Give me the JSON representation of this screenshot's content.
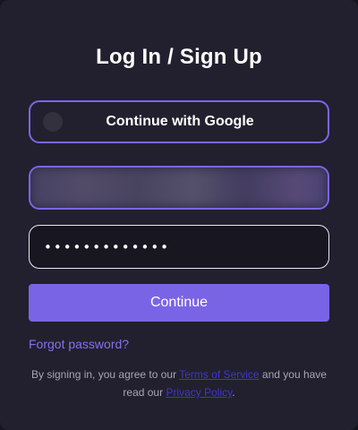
{
  "modal": {
    "title": "Log In / Sign Up"
  },
  "google": {
    "label": "Continue with Google",
    "icon": "google-icon"
  },
  "email": {
    "state": "blurred"
  },
  "password": {
    "masked_value": "•••••••••••••"
  },
  "continue": {
    "label": "Continue"
  },
  "forgot": {
    "label": "Forgot password?"
  },
  "legal": {
    "prefix": "By signing in, you agree to our ",
    "terms_link": "Terms of Service",
    "middle": " and you have read our ",
    "privacy_link": "Privacy Policy",
    "suffix": "."
  },
  "colors": {
    "background": "#22202e",
    "accent": "#7a64e6",
    "link": "#8571ef",
    "legal_link": "#3f36c8",
    "muted_text": "#a7a4b4"
  }
}
